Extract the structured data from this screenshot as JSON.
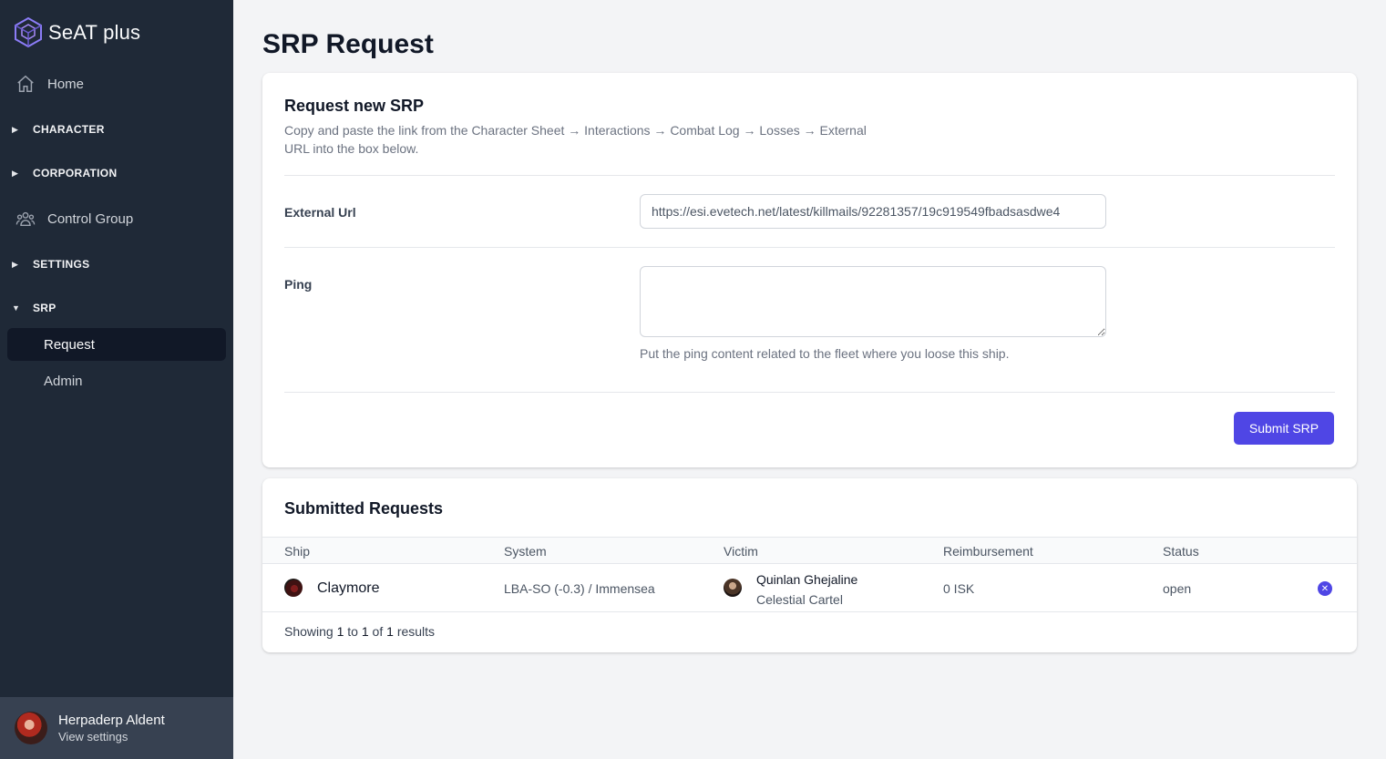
{
  "app": {
    "name": "SeAT plus"
  },
  "sidebar": {
    "home": "Home",
    "sections": [
      "CHARACTER",
      "CORPORATION",
      "SETTINGS",
      "SRP"
    ],
    "control_group": "Control Group",
    "srp_items": [
      "Request",
      "Admin"
    ]
  },
  "user": {
    "name": "Herpaderp Aldent",
    "link": "View settings"
  },
  "page": {
    "title": "SRP Request"
  },
  "request_form": {
    "title": "Request new SRP",
    "description": "Copy and paste the link from the Character Sheet → Interactions → Combat Log → Losses → External URL into the box below.",
    "external_url_label": "External Url",
    "external_url_value": "https://esi.evetech.net/latest/killmails/92281357/19c919549fbadsasdwe4",
    "ping_label": "Ping",
    "ping_value": "",
    "ping_help": "Put the ping content related to the fleet where you loose this ship.",
    "submit_label": "Submit SRP"
  },
  "requests": {
    "title": "Submitted Requests",
    "columns": [
      "Ship",
      "System",
      "Victim",
      "Reimbursement",
      "Status"
    ],
    "rows": [
      {
        "ship": "Claymore",
        "system": "LBA-SO (-0.3) / Immensea",
        "victim_name": "Quinlan Ghejaline",
        "victim_corp": "Celestial Cartel",
        "reimbursement": "0 ISK",
        "status": "open"
      }
    ],
    "footer": {
      "prefix": "Showing",
      "from": "1",
      "to_word": "to",
      "to": "1",
      "of_word": "of",
      "total": "1",
      "suffix": "results"
    }
  },
  "colors": {
    "sidebar": "#1f2937",
    "accent": "#4f46e5",
    "background": "#f3f4f6"
  }
}
